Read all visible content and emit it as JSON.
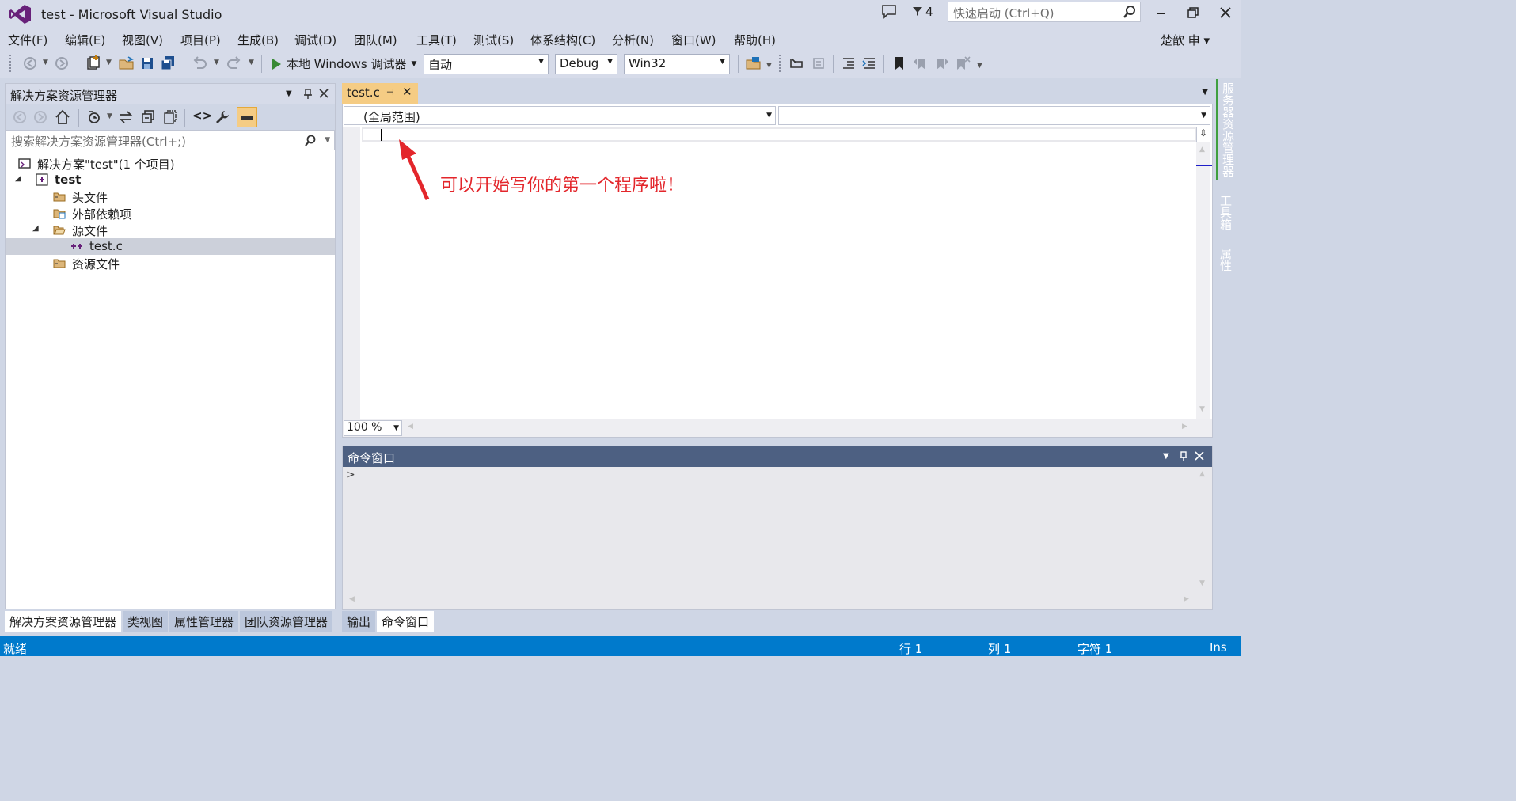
{
  "title": "test - Microsoft Visual Studio",
  "notifications": {
    "filter_count": "4"
  },
  "quicklaunch": {
    "placeholder": "快速启动 (Ctrl+Q)"
  },
  "menu": [
    "文件(F)",
    "编辑(E)",
    "视图(V)",
    "项目(P)",
    "生成(B)",
    "调试(D)",
    "团队(M)",
    "工具(T)",
    "测试(S)",
    "体系结构(C)",
    "分析(N)",
    "窗口(W)",
    "帮助(H)"
  ],
  "user": "楚歆 申",
  "toolbar": {
    "run_label": "本地 Windows 调试器",
    "config_auto": "自动",
    "config_debug": "Debug",
    "config_platform": "Win32"
  },
  "solution_explorer": {
    "title": "解决方案资源管理器",
    "search_placeholder": "搜索解决方案资源管理器(Ctrl+;)",
    "tree": [
      {
        "label": "解决方案\"test\"(1 个项目)"
      },
      {
        "label": "test"
      },
      {
        "label": "头文件"
      },
      {
        "label": "外部依赖项"
      },
      {
        "label": "源文件"
      },
      {
        "label": "test.c"
      },
      {
        "label": "资源文件"
      }
    ]
  },
  "left_tabs": [
    "解决方案资源管理器",
    "类视图",
    "属性管理器",
    "团队资源管理器"
  ],
  "editor": {
    "tab_label": "test.c",
    "scope": "(全局范围)",
    "zoom": "100 %",
    "annotation": "可以开始写你的第一个程序啦！"
  },
  "command_window": {
    "title": "命令窗口",
    "prompt": ">"
  },
  "bottom_tabs": [
    "输出",
    "命令窗口"
  ],
  "side_tabs": [
    "服务器资源管理器",
    "工具箱",
    "属性"
  ],
  "status": {
    "ready": "就绪",
    "line": "行 1",
    "col": "列 1",
    "char": "字符 1",
    "mode": "Ins"
  },
  "colors": {
    "accent": "#007acc",
    "tab_active": "#f5cc84",
    "panel_header": "#4d6082",
    "annotation": "#e3262b"
  }
}
